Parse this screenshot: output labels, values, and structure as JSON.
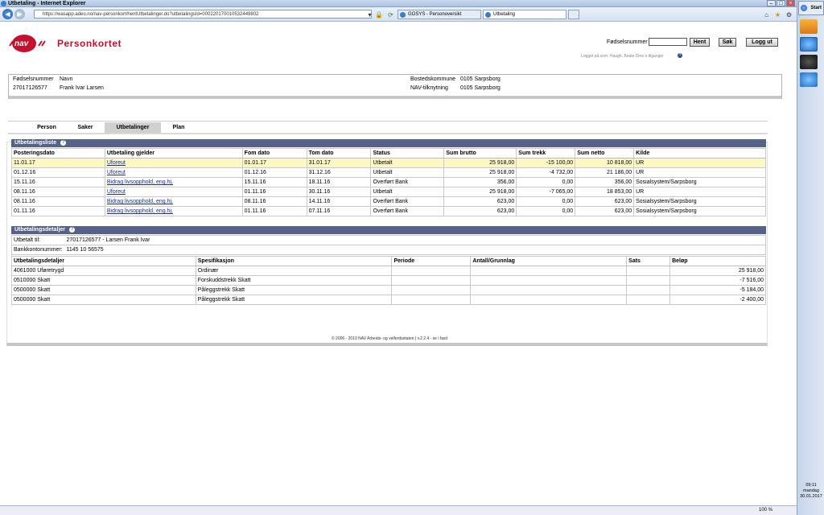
{
  "window": {
    "title": "Utbetaling - Internet Explorer"
  },
  "browser": {
    "url": "https://wasapp.adeo.no/nav-personkort/hentUtbetalinger.do?utbetalingsId=000220170010532449802",
    "tabs": [
      {
        "label": "GOSYS - Personoversikt"
      },
      {
        "label": "Utbetaling"
      }
    ]
  },
  "header": {
    "logo_text": "nav",
    "app_title": "Personkortet",
    "fnr_label": "Fødselsnummer",
    "hent_label": "Hent",
    "sok_label": "Søk",
    "logout_label": "Logg ut",
    "logged_in_text": "Logget på som: Haugh, Beate Dine e tilganger"
  },
  "person": {
    "fnr_header": "Fødselsnummer",
    "name_header": "Navn",
    "fnr": "27017126577",
    "name": "Frank Ivar Larsen",
    "bosted_label": "Bostedskommune",
    "bosted_value": "0105 Sarpsborg",
    "nav_label": "NAV-tilknytning",
    "nav_value": "0105 Sarpsborg"
  },
  "tabs": [
    "Person",
    "Saker",
    "Utbetalinger",
    "Plan"
  ],
  "utbetalingsliste": {
    "title": "Utbetalingsliste",
    "columns": [
      "Posteringsdato",
      "Utbetaling gjelder",
      "Fom dato",
      "Tom dato",
      "Status",
      "Sum brutto",
      "Sum trekk",
      "Sum netto",
      "Kilde"
    ],
    "rows": [
      [
        "11.01.17",
        "Uforeut",
        "01.01.17",
        "31.01.17",
        "Utbetalt",
        "25 918,00",
        "-15 100,00",
        "10 818,00",
        "UR"
      ],
      [
        "01.12.16",
        "Uforeut",
        "01.12.16",
        "31.12.16",
        "Utbetalt",
        "25 918,00",
        "-4 732,00",
        "21 186,00",
        "UR"
      ],
      [
        "15.11.16",
        "Bidrag livsopphold, eng.hj.",
        "15.11.16",
        "18.11.16",
        "Overført Bank",
        "356,00",
        "0,00",
        "356,00",
        "Sosialsystem/Sarpsborg"
      ],
      [
        "08.11.16",
        "Uforeut",
        "01.11.16",
        "30.11.16",
        "Utbetalt",
        "25 918,00",
        "-7 065,00",
        "18 853,00",
        "UR"
      ],
      [
        "08.11.16",
        "Bidrag livsopphold, eng.hj.",
        "08.11.16",
        "14.11.16",
        "Overført Bank",
        "623,00",
        "0,00",
        "623,00",
        "Sosialsystem/Sarpsborg"
      ],
      [
        "01.11.16",
        "Bidrag livsopphold, eng.hj.",
        "01.11.16",
        "07.11.16",
        "Overført Bank",
        "623,00",
        "0,00",
        "623,00",
        "Sosialsystem/Sarpsborg"
      ]
    ]
  },
  "utbetalingsdetaljer": {
    "title": "Utbetalingsdetaljer",
    "utbetalt_til_label": "Utbetalt til:",
    "utbetalt_til_value": "27017126577 - Larsen Frank Ivar",
    "bankkonto_label": "Bankkontonummer:",
    "bankkonto_value": "1145 10 56575",
    "columns": [
      "Utbetalingsdetaljer",
      "Spesifikasjon",
      "Periode",
      "Antall/Grunnlag",
      "Sats",
      "Beløp"
    ],
    "rows": [
      [
        "4061000 Uføretrygd",
        "Ordinær",
        "",
        "",
        "",
        "25 918,00"
      ],
      [
        "0510000 Skatt",
        "Forskuddstrekk Skatt",
        "",
        "",
        "",
        "-7 516,00"
      ],
      [
        "0500000 Skatt",
        "Påleggstrekk Skatt",
        "",
        "",
        "",
        "-5 184,00"
      ],
      [
        "0500000 Skatt",
        "Påleggstrekk Skatt",
        "",
        "",
        "",
        "-2 400,00"
      ]
    ]
  },
  "footer": {
    "text": "© 2006 - 2010 NAV Arbeids- og velferdsetaten | v.2.2.4 - se i fasit"
  },
  "statusbar": {
    "zoom": "100 %"
  },
  "taskbar": {
    "start": "Start",
    "time": "09:11",
    "day": "mandag",
    "date": "30.01.2017"
  }
}
